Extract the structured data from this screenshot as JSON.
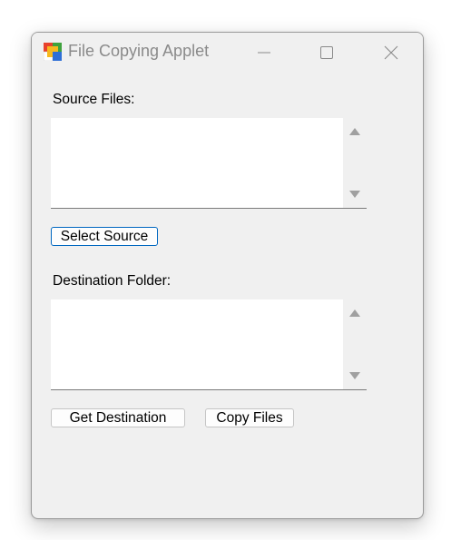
{
  "window": {
    "title": "File Copying Applet",
    "app_icon": "app-window-icon",
    "controls": {
      "minimize_icon": "minimize-icon",
      "maximize_icon": "maximize-icon",
      "close_icon": "close-icon"
    }
  },
  "source": {
    "label": "Source Files:",
    "value": "",
    "select_button": "Select Source"
  },
  "destination": {
    "label": "Destination Folder:",
    "value": "",
    "get_button": "Get Destination"
  },
  "actions": {
    "copy_button": "Copy Files"
  },
  "colors": {
    "window_bg": "#f0f0f0",
    "accent_border": "#0067c0",
    "title_text": "#8a8a8a"
  }
}
